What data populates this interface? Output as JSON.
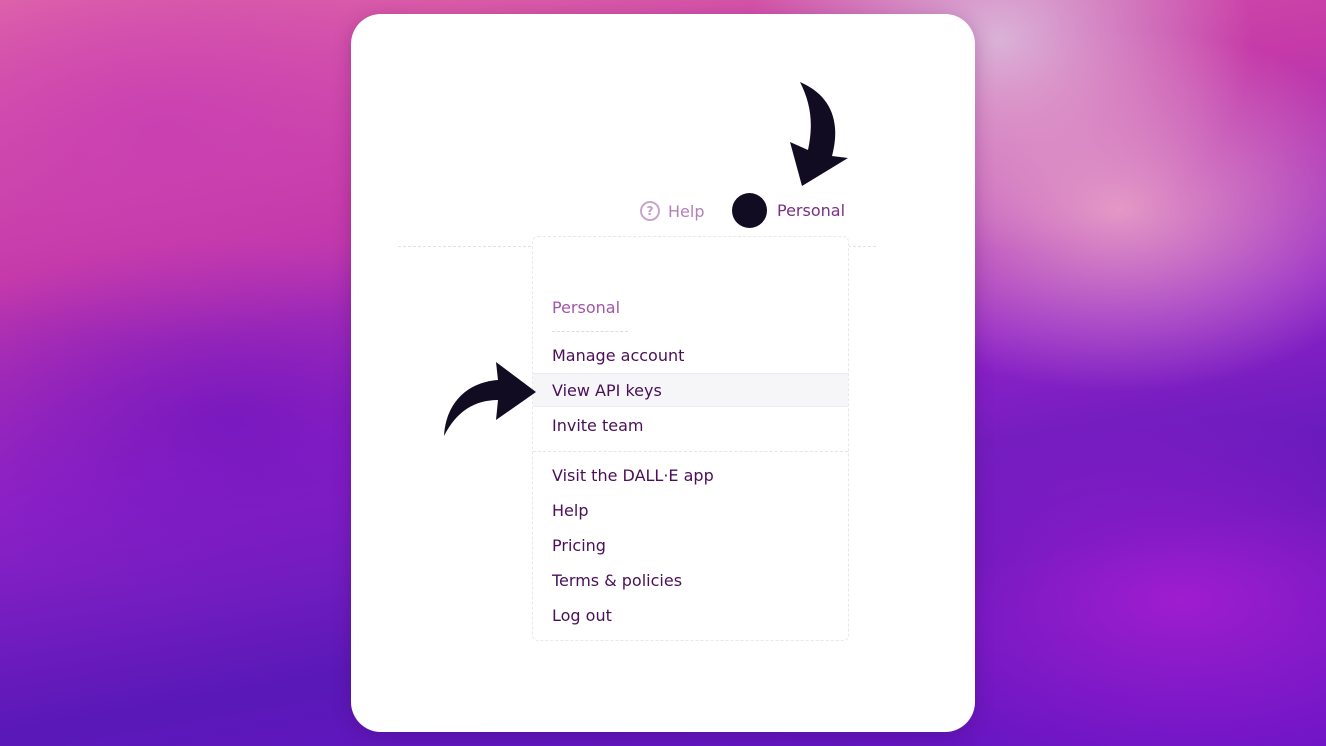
{
  "header": {
    "help_label": "Help",
    "account_label": "Personal"
  },
  "menu": {
    "section_title": "Personal",
    "account_items": [
      {
        "label": "Manage account"
      },
      {
        "label": "View API keys"
      },
      {
        "label": "Invite team"
      }
    ],
    "general_items": [
      {
        "label": "Visit the DALL·E app"
      },
      {
        "label": "Help"
      },
      {
        "label": "Pricing"
      },
      {
        "label": "Terms & policies"
      },
      {
        "label": "Log out"
      }
    ]
  },
  "annotations": {
    "arrow_color": "#120c22",
    "highlighted_item": "View API keys"
  }
}
